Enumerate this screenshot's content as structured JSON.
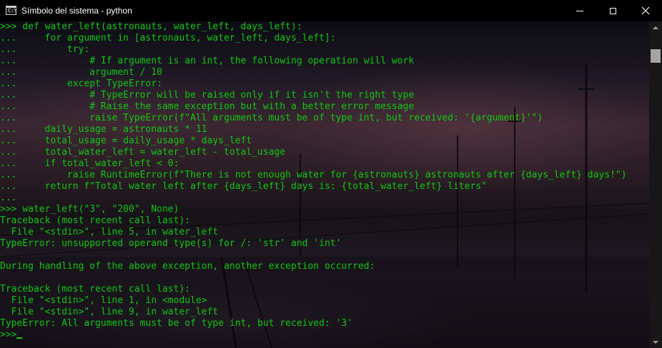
{
  "window": {
    "title": "Símbolo del sistema - python",
    "app_icon": "cmd-icon",
    "buttons": {
      "minimize": "minimize-icon",
      "maximize": "maximize-icon",
      "close": "close-icon"
    }
  },
  "console": {
    "text_color": "#13c713",
    "lines": [
      ">>> def water_left(astronauts, water_left, days_left):",
      "...     for argument in [astronauts, water_left, days_left]:",
      "...         try:",
      "...             # If argument is an int, the following operation will work",
      "...             argument / 10",
      "...         except TypeError:",
      "...             # TypeError will be raised only if it isn't the right type",
      "...             # Raise the same exception but with a better error message",
      "...             raise TypeError(f\"All arguments must be of type int, but received: '{argument}'\")",
      "...     daily_usage = astronauts * 11",
      "...     total_usage = daily_usage * days_left",
      "...     total_water_left = water_left - total_usage",
      "...     if total_water_left < 0:",
      "...         raise RuntimeError(f\"There is not enough water for {astronauts} astronauts after {days_left} days!\")",
      "...     return f\"Total water left after {days_left} days is: {total_water_left} liters\"",
      "...",
      ">>> water_left(\"3\", \"200\", None)",
      "Traceback (most recent call last):",
      "  File \"<stdin>\", line 5, in water_left",
      "TypeError: unsupported operand type(s) for /: 'str' and 'int'",
      "",
      "During handling of the above exception, another exception occurred:",
      "",
      "Traceback (most recent call last):",
      "  File \"<stdin>\", line 1, in <module>",
      "  File \"<stdin>\", line 9, in water_left",
      "TypeError: All arguments must be of type int, but received: '3'"
    ],
    "prompt": ">>>"
  },
  "scrollbar": {
    "up_icon": "scroll-up-arrow-icon",
    "down_icon": "scroll-down-arrow-icon"
  }
}
